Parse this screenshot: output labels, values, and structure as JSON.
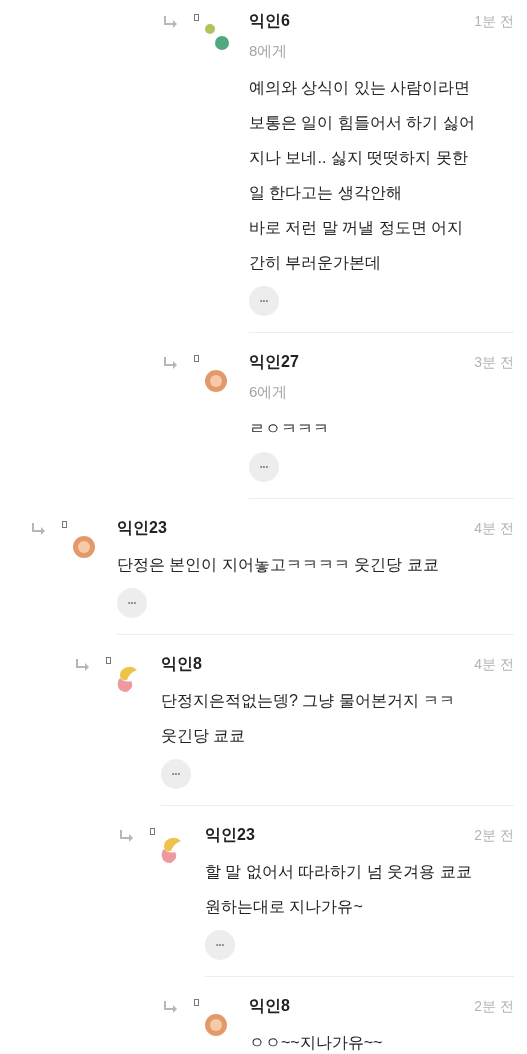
{
  "comments": [
    {
      "children": [
        {
          "children": [
            {
              "children": [
                {
                  "author": "익인6",
                  "time": "1분 전",
                  "avatar": {
                    "kind": "dots"
                  },
                  "reply_to": "8에게",
                  "lines": [
                    "예의와 상식이 있는 사람이라면",
                    "보통은 일이 힘들어서 하기 싫어",
                    "지나 보네.. 싫지 떳떳하지 못한",
                    "일 한다고는 생각안해",
                    "바로 저런 말 꺼낼 정도면 어지",
                    "간히 부러운가본데"
                  ],
                  "more": "•••"
                },
                {
                  "author": "익인27",
                  "time": "3분 전",
                  "avatar": {
                    "kind": "ring"
                  },
                  "reply_to": "6에게",
                  "lines": [
                    "ㄹㅇㅋㅋㅋ"
                  ],
                  "more": "•••"
                }
              ]
            }
          ]
        }
      ]
    },
    {
      "author": "익인23",
      "time": "4분 전",
      "avatar": {
        "kind": "ring"
      },
      "lines": [
        "단정은 본인이 지어놓고ㅋㅋㅋㅋ 웃긴당 쿄쿄"
      ],
      "more": "•••",
      "children": [
        {
          "author": "익인8",
          "time": "4분 전",
          "avatar": {
            "kind": "blob"
          },
          "lines": [
            "단정지은적없는뎅? 그냥 물어본거지 ㅋㅋ",
            "웃긴당 쿄쿄"
          ],
          "more": "•••",
          "children": [
            {
              "author": "익인23",
              "time": "2분 전",
              "avatar": {
                "kind": "blob"
              },
              "lines": [
                "할 말 없어서 따라하기 넘 웃겨용 쿄쿄",
                "원하는대로 지나가유~"
              ],
              "more": "•••",
              "children": [
                {
                  "author": "익인8",
                  "time": "2분 전",
                  "avatar": {
                    "kind": "ring"
                  },
                  "lines": [
                    "ㅇㅇ~~지나가유~~"
                  ]
                }
              ]
            }
          ]
        }
      ]
    }
  ]
}
